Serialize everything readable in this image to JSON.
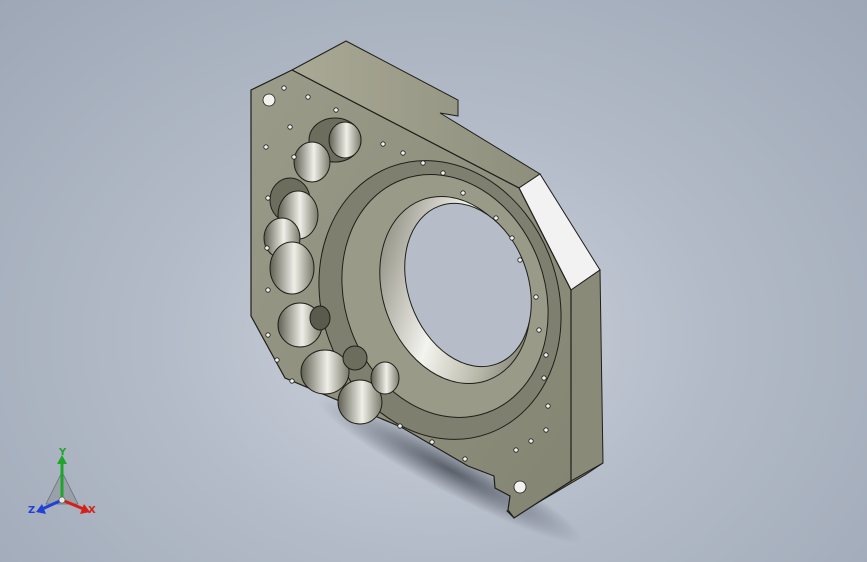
{
  "viewport": {
    "background_top": "#cdd3dd",
    "background_bottom": "#9ea7b6"
  },
  "model": {
    "body_color": "#8f8f7e",
    "edge_color": "#1f1f1a",
    "highlight_color": "#f2f2f2"
  },
  "triad": {
    "x_label": "X",
    "y_label": "Y",
    "z_label": "Z",
    "x_color": "#d4201a",
    "y_color": "#1fa52a",
    "z_color": "#2141d6"
  }
}
